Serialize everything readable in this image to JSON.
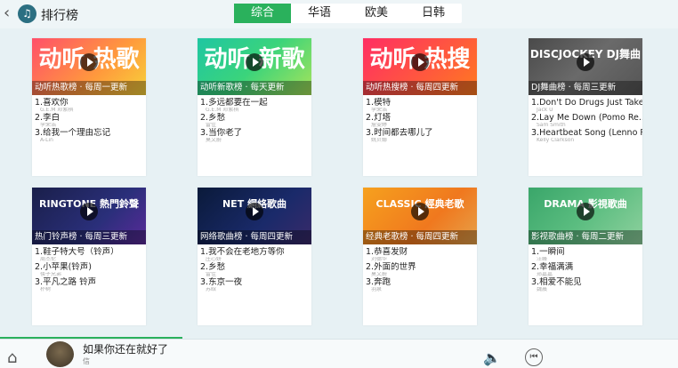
{
  "header": {
    "back_icon": "back-arrow-icon",
    "logo_icon": "app-logo-icon",
    "title": "排行榜"
  },
  "tabs": [
    {
      "label": "综合",
      "active": true
    },
    {
      "label": "华语"
    },
    {
      "label": "欧美"
    },
    {
      "label": "日韩"
    }
  ],
  "cards": [
    {
      "art": "动听 热歌",
      "band": "动听热歌榜 · 每周一更新",
      "songs": [
        {
          "n": "1.喜欢你",
          "a": "G.E.M 邓紫棋"
        },
        {
          "n": "2.李白",
          "a": "李荣浩"
        },
        {
          "n": "3.给我一个理由忘记",
          "a": "A-Lin"
        }
      ]
    },
    {
      "art": "动听 新歌",
      "band": "动听新歌榜 · 每天更新",
      "songs": [
        {
          "n": "1.多远都要在一起",
          "a": "G.E.M 邓紫棋"
        },
        {
          "n": "2.乡愁",
          "a": "雷佳"
        },
        {
          "n": "3.当你老了",
          "a": "莫文蔚"
        }
      ]
    },
    {
      "art": "动听 热搜",
      "band": "动听热搜榜 · 每周四更新",
      "songs": [
        {
          "n": "1.模特",
          "a": "李荣浩"
        },
        {
          "n": "2.灯塔",
          "a": "詹雯婷"
        },
        {
          "n": "3.时间都去哪儿了",
          "a": "姚贝娜"
        }
      ]
    },
    {
      "art": "DISCJOCKEY DJ舞曲",
      "band": "DJ舞曲榜 · 每周三更新",
      "songs": [
        {
          "n": "1.Don't Do Drugs Just Take...",
          "a": "Jack U"
        },
        {
          "n": "2.Lay Me Down (Pomo Re...",
          "a": "Sam Smith"
        },
        {
          "n": "3.Heartbeat Song (Lenno R...",
          "a": "Kelly Clarkson"
        }
      ]
    },
    {
      "art": "RINGTONE 熱門鈴聲",
      "band": "热门铃声榜 · 每周三更新",
      "songs": [
        {
          "n": "1.鞋子特大号（铃声）",
          "a": "周杰伦"
        },
        {
          "n": "2.小苹果(铃声)",
          "a": "筷子兄弟"
        },
        {
          "n": "3.平凡之路 铃声",
          "a": "朴树"
        }
      ]
    },
    {
      "art": "NET 網絡歌曲",
      "band": "网络歌曲榜 · 每周四更新",
      "songs": [
        {
          "n": "1.我不会在老地方等你",
          "a": "庄心妍"
        },
        {
          "n": "2.乡愁",
          "a": "雷佳"
        },
        {
          "n": "3.东京一夜",
          "a": "苏晗"
        }
      ]
    },
    {
      "art": "CLASSIC 經典老歌",
      "band": "经典老歌榜 · 每周四更新",
      "songs": [
        {
          "n": "1.恭喜发财",
          "a": "刘德华"
        },
        {
          "n": "2.外面的世界",
          "a": "莫文蔚"
        },
        {
          "n": "3.奔跑",
          "a": "羽泉"
        }
      ]
    },
    {
      "art": "DRAMA 影視歌曲",
      "band": "影视歌曲榜 · 每周二更新",
      "songs": [
        {
          "n": "1.一瞬间",
          "a": "汪峰"
        },
        {
          "n": "2.幸福满满",
          "a": "郑嘉嘉"
        },
        {
          "n": "3.相爱不能见",
          "a": "魏晨"
        }
      ]
    }
  ],
  "player": {
    "title": "如果你还在就好了",
    "artist": "信",
    "home_icon": "home-icon",
    "volume_icon": "volume-icon",
    "prev_icon": "previous-icon"
  }
}
